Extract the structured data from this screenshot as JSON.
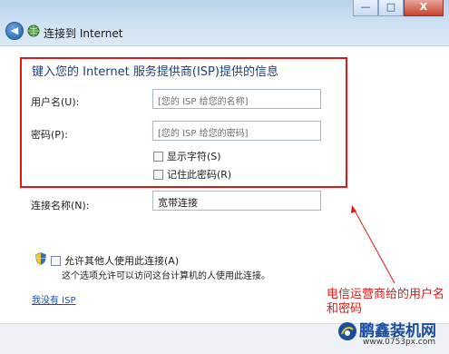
{
  "window": {
    "title": "连接到 Internet",
    "controls": {
      "minimize": "—",
      "maximize": "□",
      "close": "X"
    }
  },
  "form": {
    "heading": "键入您的 Internet 服务提供商(ISP)提供的信息",
    "username_label": "用户名(U):",
    "username_placeholder": "[您的 ISP 给您的名称]",
    "password_label": "密码(P):",
    "password_placeholder": "[您的 ISP 给您的密码]",
    "show_chars_label": "显示字符(S)",
    "remember_password_label": "记住此密码(R)",
    "connection_name_label": "连接名称(N):",
    "connection_name_value": "宽带连接",
    "allow_others_label": "允许其他人使用此连接(A)",
    "allow_others_hint": "这个选项允许可以访问这台计算机的人使用此连接。",
    "no_isp_link": "我没有 ISP"
  },
  "annotation": {
    "text": "电信运营商给的用户名和密码",
    "color": "#e01818"
  },
  "watermark": {
    "brand": "鹏鑫装机网",
    "url": "www.0753px.com"
  }
}
